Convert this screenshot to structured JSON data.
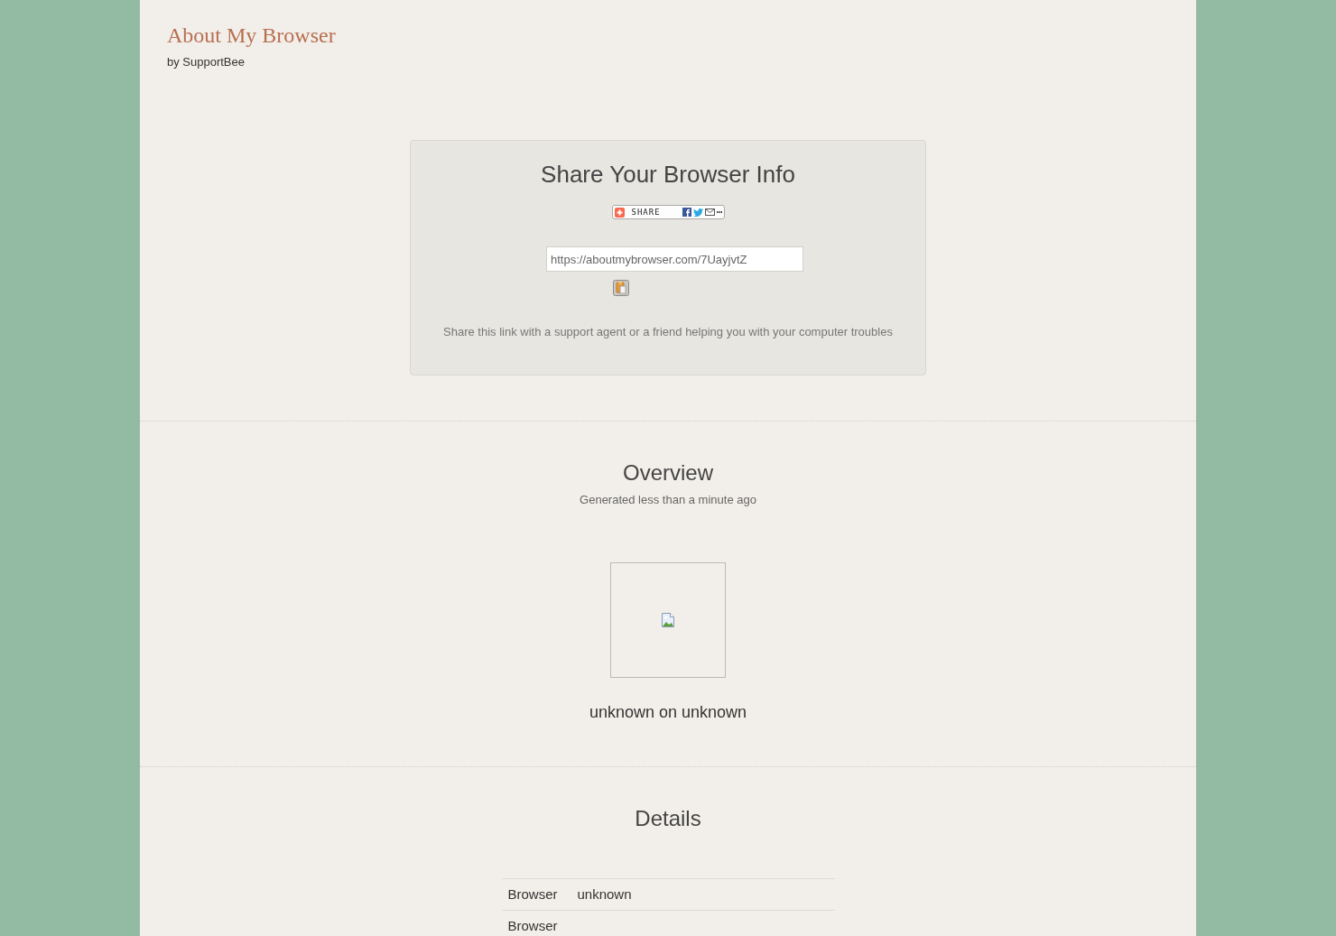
{
  "header": {
    "title": "About My Browser",
    "byline": "by SupportBee"
  },
  "share_panel": {
    "heading": "Share Your Browser Info",
    "share_button": {
      "label": "SHARE"
    },
    "link_field": {
      "value": "https://aboutmybrowser.com/7UayjvtZ"
    },
    "note": "Share this link with a support agent or a friend helping you with your computer troubles"
  },
  "overview": {
    "heading": "Overview",
    "generated": "Generated less than a minute ago",
    "summary": "unknown on unknown"
  },
  "details": {
    "heading": "Details",
    "rows": [
      {
        "label": "Browser",
        "value": "unknown"
      },
      {
        "label": "Browser"
      }
    ]
  }
}
